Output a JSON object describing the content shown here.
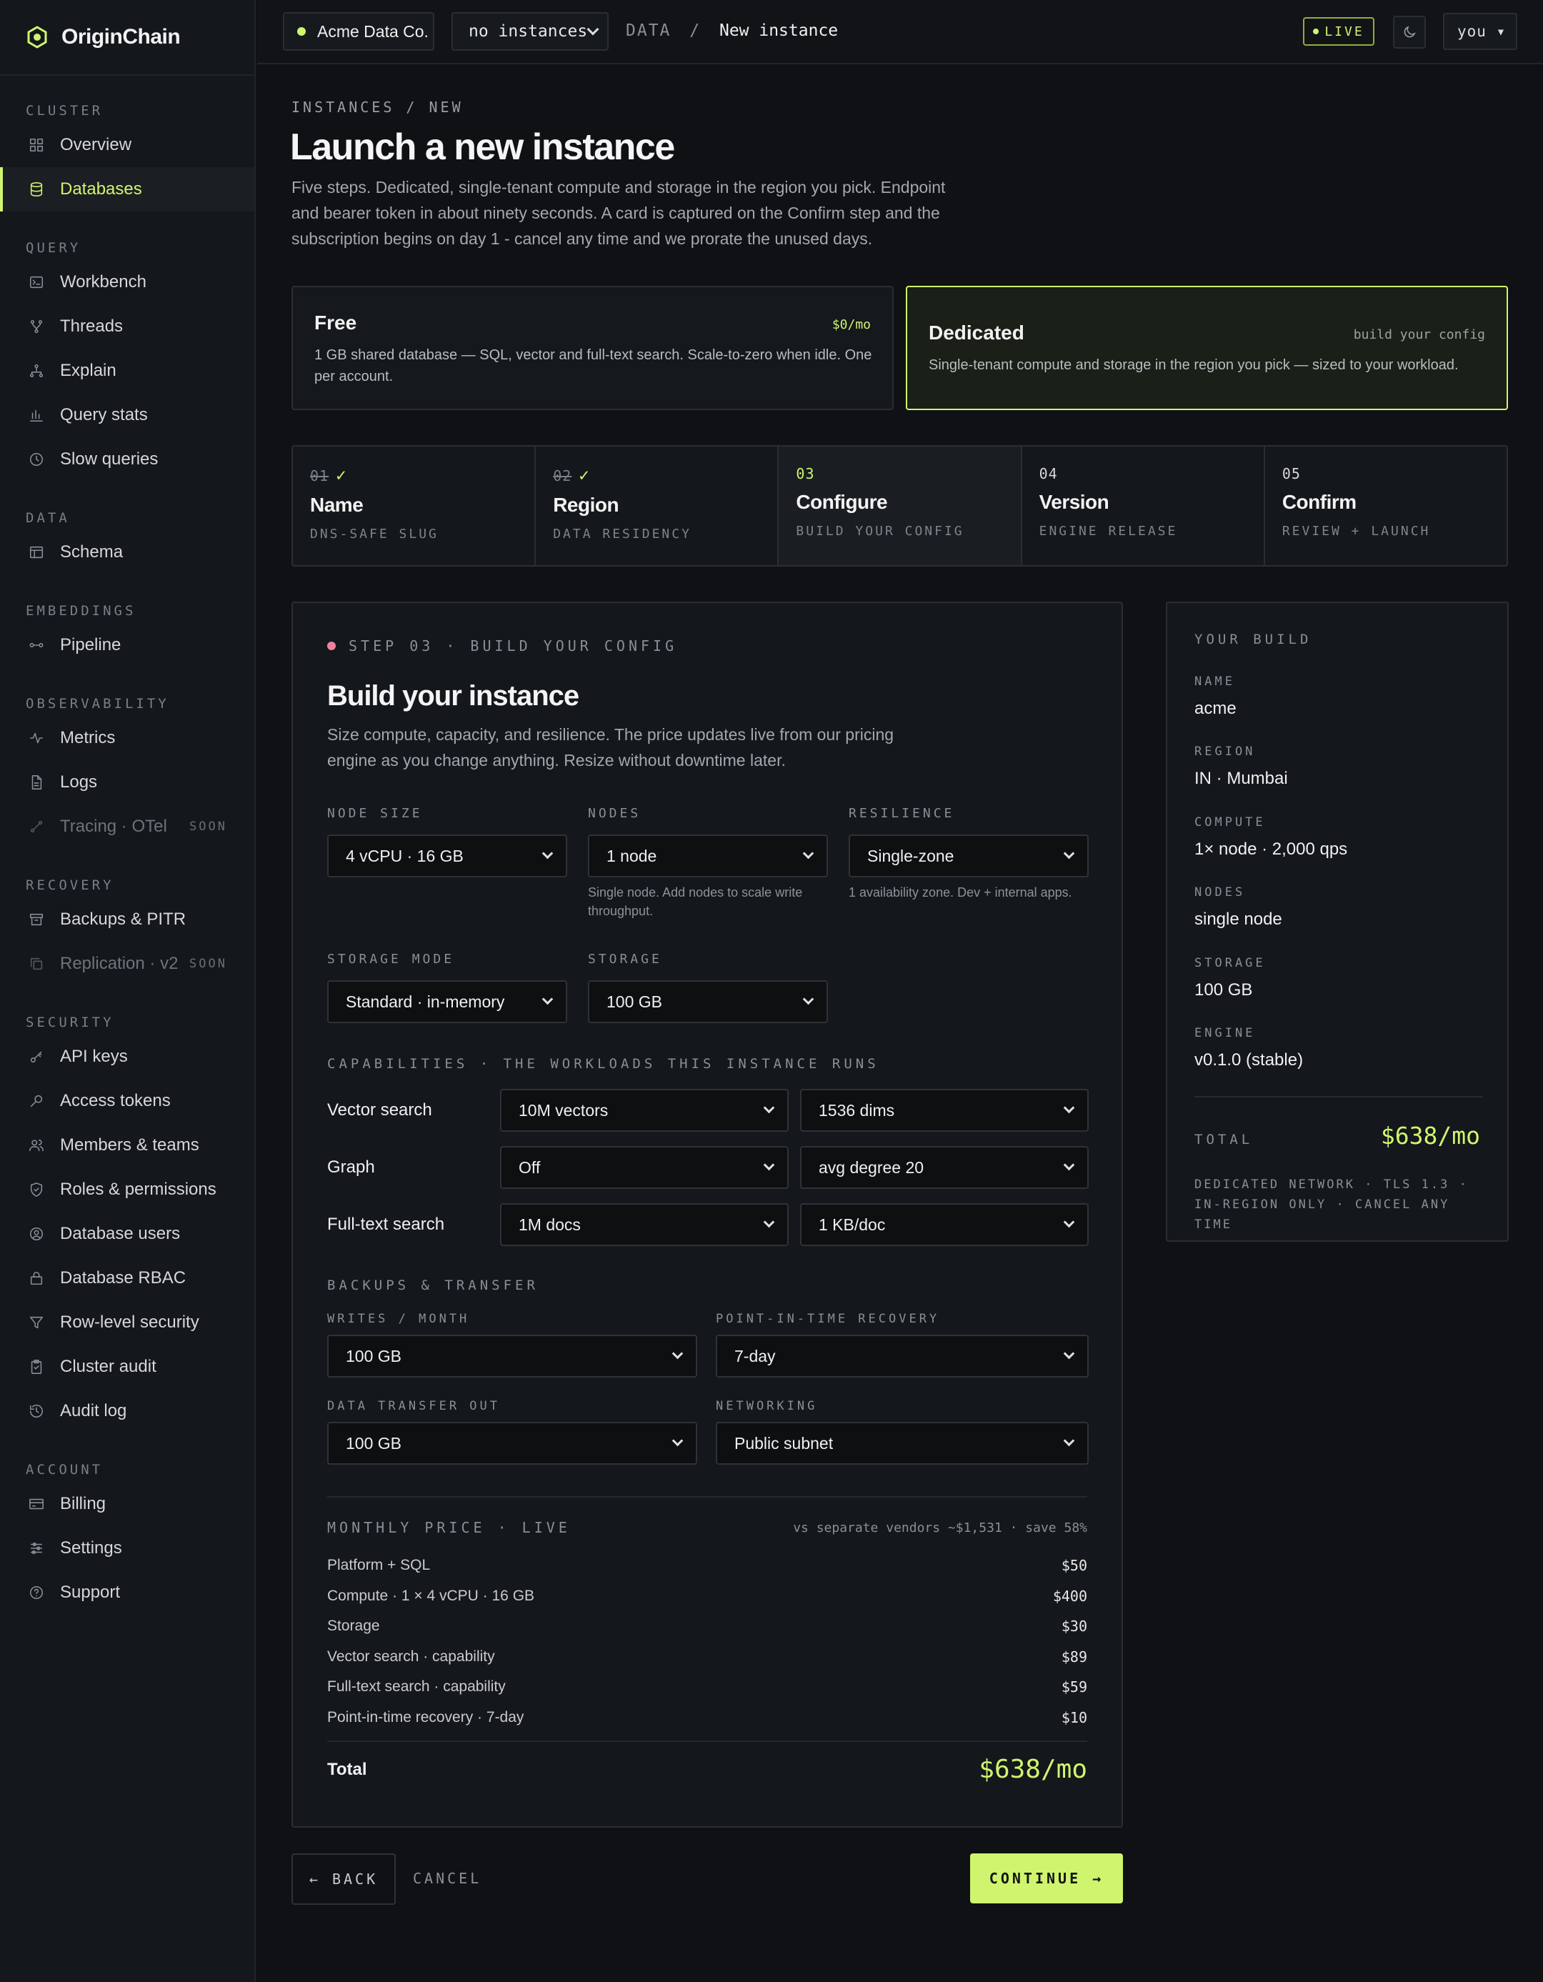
{
  "brand": {
    "name": "OriginChain",
    "accent": "#cff56f"
  },
  "sidebar": {
    "groups": [
      {
        "title": "CLUSTER",
        "items": [
          {
            "label": "Overview",
            "icon": "grid-icon"
          },
          {
            "label": "Databases",
            "icon": "database-icon",
            "active": true
          }
        ]
      },
      {
        "title": "QUERY",
        "items": [
          {
            "label": "Workbench",
            "icon": "terminal-icon"
          },
          {
            "label": "Threads",
            "icon": "branch-icon"
          },
          {
            "label": "Explain",
            "icon": "tree-icon"
          },
          {
            "label": "Query stats",
            "icon": "bar-chart-icon"
          },
          {
            "label": "Slow queries",
            "icon": "clock-icon"
          }
        ]
      },
      {
        "title": "DATA",
        "items": [
          {
            "label": "Schema",
            "icon": "table-icon"
          }
        ]
      },
      {
        "title": "EMBEDDINGS",
        "items": [
          {
            "label": "Pipeline",
            "icon": "pipeline-icon"
          }
        ]
      },
      {
        "title": "OBSERVABILITY",
        "items": [
          {
            "label": "Metrics",
            "icon": "pulse-icon"
          },
          {
            "label": "Logs",
            "icon": "file-icon"
          },
          {
            "label": "Tracing · OTel",
            "icon": "trace-icon",
            "soon": "SOON"
          }
        ]
      },
      {
        "title": "RECOVERY",
        "items": [
          {
            "label": "Backups & PITR",
            "icon": "archive-icon"
          },
          {
            "label": "Replication · v2",
            "icon": "copy-icon",
            "soon": "SOON"
          }
        ]
      },
      {
        "title": "SECURITY",
        "items": [
          {
            "label": "API keys",
            "icon": "key-icon"
          },
          {
            "label": "Access tokens",
            "icon": "token-icon"
          },
          {
            "label": "Members & teams",
            "icon": "users-icon"
          },
          {
            "label": "Roles & permissions",
            "icon": "shield-icon"
          },
          {
            "label": "Database users",
            "icon": "user-circle-icon"
          },
          {
            "label": "Database RBAC",
            "icon": "lock-icon"
          },
          {
            "label": "Row-level security",
            "icon": "filter-icon"
          },
          {
            "label": "Cluster audit",
            "icon": "clipboard-icon"
          },
          {
            "label": "Audit log",
            "icon": "history-icon"
          }
        ]
      },
      {
        "title": "ACCOUNT",
        "items": [
          {
            "label": "Billing",
            "icon": "card-icon"
          },
          {
            "label": "Settings",
            "icon": "sliders-icon"
          },
          {
            "label": "Support",
            "icon": "help-icon"
          }
        ]
      }
    ]
  },
  "topbar": {
    "org": "Acme Data Co.",
    "instance_select": "no instances",
    "crumb_section": "DATA",
    "crumb_sep": "/",
    "crumb_current": "New instance",
    "live": "LIVE",
    "user": "you ▾"
  },
  "page": {
    "eyebrow": "INSTANCES / NEW",
    "title": "Launch a new instance",
    "intro": "Five steps. Dedicated, single-tenant compute and storage in the region you pick. Endpoint and bearer token in about ninety seconds. A card is captured on the Confirm step and the subscription begins on day 1 - cancel any time and we prorate the unused days."
  },
  "plans": {
    "free": {
      "name": "Free",
      "price": "$0/mo",
      "desc": "1 GB shared database — SQL, vector and full-text search. Scale-to-zero when idle. One per account."
    },
    "dedicated": {
      "name": "Dedicated",
      "tag": "build your config",
      "desc": "Single-tenant compute and storage in the region you pick — sized to your workload."
    }
  },
  "steps": [
    {
      "num": "01",
      "check": "✓",
      "title": "Name",
      "sub": "DNS-SAFE SLUG",
      "state": "done"
    },
    {
      "num": "02",
      "check": "✓",
      "title": "Region",
      "sub": "DATA RESIDENCY",
      "state": "done"
    },
    {
      "num": "03",
      "check": "",
      "title": "Configure",
      "sub": "BUILD YOUR CONFIG",
      "state": "cur"
    },
    {
      "num": "04",
      "check": "",
      "title": "Version",
      "sub": "ENGINE RELEASE",
      "state": "up"
    },
    {
      "num": "05",
      "check": "",
      "title": "Confirm",
      "sub": "REVIEW + LAUNCH",
      "state": "up"
    }
  ],
  "config": {
    "eyebrow": "STEP 03 · BUILD YOUR CONFIG",
    "title": "Build your instance",
    "desc": "Size compute, capacity, and resilience. The price updates live from our pricing engine as you change anything. Resize without downtime later.",
    "node_size": {
      "label": "NODE SIZE",
      "value": "4 vCPU · 16 GB"
    },
    "nodes": {
      "label": "NODES",
      "value": "1 node",
      "help": "Single node. Add nodes to scale write throughput."
    },
    "resilience": {
      "label": "RESILIENCE",
      "value": "Single-zone",
      "help": "1 availability zone. Dev + internal apps."
    },
    "storage_mode": {
      "label": "STORAGE MODE",
      "value": "Standard · in-memory"
    },
    "storage": {
      "label": "STORAGE",
      "value": "100 GB"
    },
    "capabilities_label": "CAPABILITIES · THE WORKLOADS THIS INSTANCE RUNS",
    "capabilities": [
      {
        "name": "Vector search",
        "a": "10M vectors",
        "b": "1536 dims"
      },
      {
        "name": "Graph",
        "a": "Off",
        "b": "avg degree 20"
      },
      {
        "name": "Full-text search",
        "a": "1M docs",
        "b": "1 KB/doc"
      }
    ],
    "backups_label": "BACKUPS & TRANSFER",
    "writes": {
      "label": "WRITES / MONTH",
      "value": "100 GB"
    },
    "pitr": {
      "label": "POINT-IN-TIME RECOVERY",
      "value": "7-day"
    },
    "transfer": {
      "label": "DATA TRANSFER OUT",
      "value": "100 GB"
    },
    "networking": {
      "label": "NETWORKING",
      "value": "Public subnet"
    }
  },
  "pricing": {
    "label": "MONTHLY PRICE · LIVE",
    "vs": "vs separate vendors ~$1,531 · save 58%",
    "lines": [
      {
        "name": "Platform + SQL",
        "amount": "$50"
      },
      {
        "name": "Compute · 1 × 4 vCPU · 16 GB",
        "amount": "$400"
      },
      {
        "name": "Storage",
        "amount": "$30"
      },
      {
        "name": "Vector search · capability",
        "amount": "$89"
      },
      {
        "name": "Full-text search · capability",
        "amount": "$59"
      },
      {
        "name": "Point-in-time recovery · 7-day",
        "amount": "$10"
      }
    ],
    "total_label": "Total",
    "total": "$638/mo"
  },
  "actions": {
    "back": "← BACK",
    "cancel": "CANCEL",
    "continue": "CONTINUE →"
  },
  "summary": {
    "title": "YOUR BUILD",
    "rows": [
      {
        "k": "NAME",
        "v": "acme"
      },
      {
        "k": "REGION",
        "v": "IN · Mumbai"
      },
      {
        "k": "COMPUTE",
        "v": "1× node · 2,000 qps"
      },
      {
        "k": "NODES",
        "v": "single node"
      },
      {
        "k": "STORAGE",
        "v": "100 GB"
      },
      {
        "k": "ENGINE",
        "v": "v0.1.0 (stable)"
      }
    ],
    "total_label": "TOTAL",
    "total": "$638/mo",
    "note": "DEDICATED NETWORK · TLS 1.3 · IN-REGION ONLY · CANCEL ANY TIME"
  }
}
